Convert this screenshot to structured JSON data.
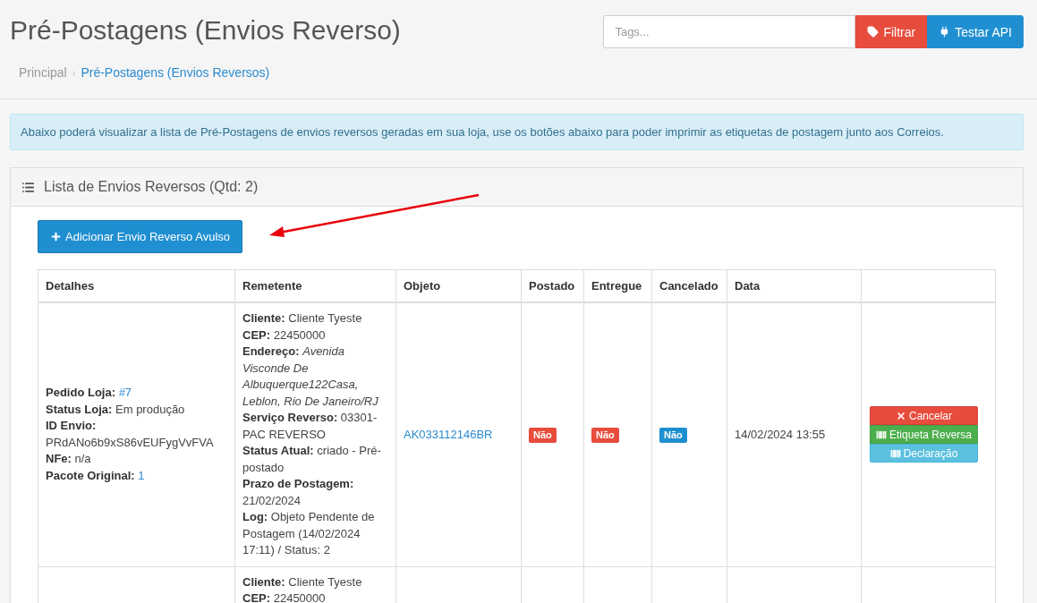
{
  "page_title": "Pré-Postagens (Envios Reverso)",
  "tags_field": {
    "placeholder": "Tags..."
  },
  "header_buttons": [
    {
      "kind": "filter",
      "label": "Filtrar"
    },
    {
      "kind": "api",
      "label": "Testar API"
    }
  ],
  "breadcrumb": {
    "separator": "›",
    "items": [
      {
        "label": "Principal",
        "selected": false
      },
      {
        "label": "Pré-Postagens (Envios Reversos)",
        "selected": true
      }
    ]
  },
  "info_alert": "Abaixo poderá visualizar a lista de Pré-Postagens de envios reversos geradas em sua loja, use os botões abaixo para poder imprimir as etiquetas de postagem junto aos Correios.",
  "panel": {
    "title": "Lista de Envios Reversos (Qtd: 2)",
    "add_button": "Adicionar Envio Reverso Avulso"
  },
  "table": {
    "columns": [
      "Detalhes",
      "Remetente",
      "Objeto",
      "Postado",
      "Entregue",
      "Cancelado",
      "Data"
    ],
    "rows": [
      {
        "details": [
          {
            "label": "Pedido Loja:",
            "value": "#7",
            "kind": "link"
          },
          {
            "label": "Status Loja:",
            "value": "Em produção",
            "kind": "text"
          },
          {
            "label": "ID Envio:",
            "value": "PRdANo6b9xS86vEUFygVvFVA",
            "kind": "text"
          },
          {
            "label": "NFe:",
            "value": "n/a",
            "kind": "text"
          },
          {
            "label": "Pacote Original:",
            "value": "1",
            "kind": "link"
          }
        ],
        "sender": [
          {
            "label": "Cliente:",
            "value": "Cliente Tyeste",
            "kind": "text"
          },
          {
            "label": "CEP:",
            "value": "22450000",
            "kind": "text"
          },
          {
            "label": "Endereço:",
            "value": "Avenida Visconde De Albuquerque122Casa, Leblon, Rio De Janeiro/RJ",
            "kind": "italic"
          },
          {
            "label": "Serviço Reverso:",
            "value": "03301-PAC REVERSO",
            "kind": "text"
          },
          {
            "label": "Status Atual:",
            "value": "criado - Pré-postado",
            "kind": "text"
          },
          {
            "label": "Prazo de Postagem:",
            "value": "21/02/2024",
            "kind": "text"
          },
          {
            "label": "Log:",
            "value": "Objeto Pendente de Postagem (14/02/2024 17:11) / Status: 2",
            "kind": "text"
          }
        ],
        "object": "AK033112146BR",
        "badges": [
          {
            "label": "Não",
            "color": "#e74c3c"
          },
          {
            "label": "Não",
            "color": "#e74c3c"
          },
          {
            "label": "Não",
            "color": "#1f8fd1"
          }
        ],
        "date": "14/02/2024 13:55",
        "actions": [
          {
            "kind": "cancel",
            "label": "Cancelar"
          },
          {
            "kind": "label",
            "label": "Etiqueta Reversa"
          },
          {
            "kind": "declaration",
            "label": "Declaração"
          }
        ]
      },
      {
        "sender": [
          {
            "label": "Cliente:",
            "value": "Cliente Tyeste",
            "kind": "text"
          },
          {
            "label": "CEP:",
            "value": "22450000",
            "kind": "text"
          }
        ]
      }
    ]
  }
}
